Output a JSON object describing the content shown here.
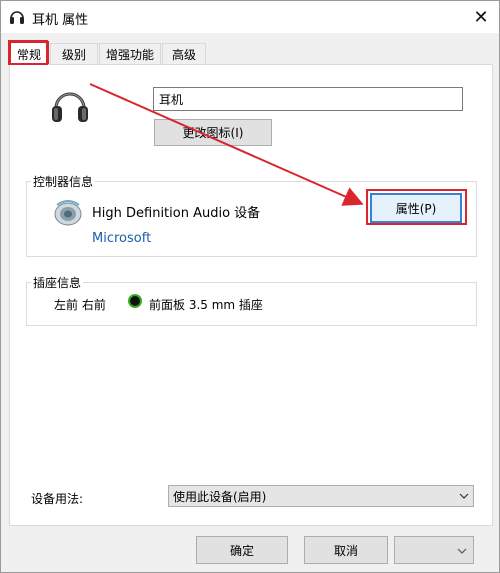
{
  "window": {
    "title": "耳机 属性",
    "close_glyph": "✕"
  },
  "tabs": [
    {
      "label": "常规",
      "active": true
    },
    {
      "label": "级别",
      "active": false
    },
    {
      "label": "增强功能",
      "active": false
    },
    {
      "label": "高级",
      "active": false
    }
  ],
  "general": {
    "device_name_value": "耳机",
    "change_icon_label": "更改图标(I)",
    "controller_group_label": "控制器信息",
    "controller_name": "High Definition Audio 设备",
    "controller_vendor": "Microsoft",
    "properties_label": "属性(P)",
    "jack_group_label": "插座信息",
    "jack_position": "左前 右前",
    "jack_description": "前面板 3.5 mm 插座",
    "device_usage_label": "设备用法:",
    "device_usage_value": "使用此设备(启用)"
  },
  "footer": {
    "ok_label": "确定",
    "cancel_label": "取消",
    "apply_label": ""
  },
  "icons": {
    "title": "headphones-icon",
    "device": "headphones-icon",
    "controller": "speaker-icon",
    "jack": "green-jack-icon",
    "dropdown": "chevron-down-icon"
  },
  "colors": {
    "annotation": "#d9262e",
    "link": "#1b5eab",
    "jack": "#33b11c"
  }
}
